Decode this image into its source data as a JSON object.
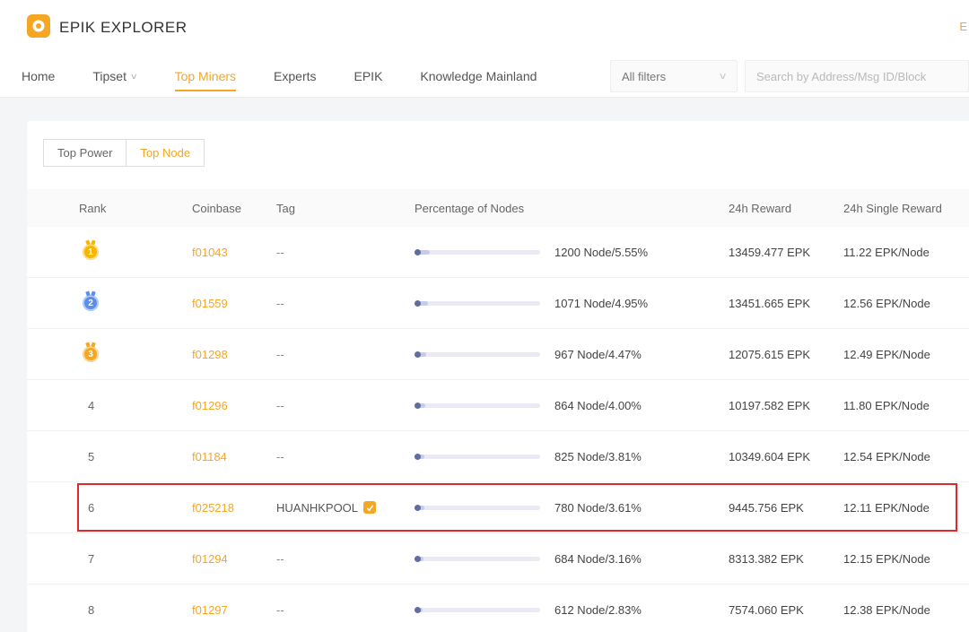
{
  "brand": {
    "name": "EPIK EXPLORER",
    "lang": "E"
  },
  "nav": {
    "items": [
      {
        "label": "Home"
      },
      {
        "label": "Tipset",
        "has_dropdown": true
      },
      {
        "label": "Top Miners",
        "active": true
      },
      {
        "label": "Experts"
      },
      {
        "label": "EPIK"
      },
      {
        "label": "Knowledge Mainland"
      }
    ]
  },
  "filters": {
    "all_filters_label": "All filters",
    "search_placeholder": "Search by Address/Msg ID/Block"
  },
  "tabs": {
    "top_power": "Top Power",
    "top_node": "Top Node"
  },
  "table": {
    "headers": [
      "Rank",
      "Coinbase",
      "Tag",
      "Percentage of Nodes",
      "24h Reward",
      "24h Single Reward"
    ],
    "rows": [
      {
        "rank": "1",
        "medal_color": "#f7b500",
        "coinbase": "f01043",
        "tag": "--",
        "nodes_text": "1200 Node/5.55%",
        "pct": 5.55,
        "reward": "13459.477 EPK",
        "single_reward": "11.22 EPK/Node"
      },
      {
        "rank": "2",
        "medal_color": "#5b8def",
        "coinbase": "f01559",
        "tag": "--",
        "nodes_text": "1071 Node/4.95%",
        "pct": 4.95,
        "reward": "13451.665 EPK",
        "single_reward": "12.56 EPK/Node"
      },
      {
        "rank": "3",
        "medal_color": "#f5a623",
        "coinbase": "f01298",
        "tag": "--",
        "nodes_text": "967 Node/4.47%",
        "pct": 4.47,
        "reward": "12075.615 EPK",
        "single_reward": "12.49 EPK/Node"
      },
      {
        "rank": "4",
        "coinbase": "f01296",
        "tag": "--",
        "nodes_text": "864 Node/4.00%",
        "pct": 4.0,
        "reward": "10197.582 EPK",
        "single_reward": "11.80 EPK/Node"
      },
      {
        "rank": "5",
        "coinbase": "f01184",
        "tag": "--",
        "nodes_text": "825 Node/3.81%",
        "pct": 3.81,
        "reward": "10349.604 EPK",
        "single_reward": "12.54 EPK/Node"
      },
      {
        "rank": "6",
        "coinbase": "f025218",
        "tag": "HUANHKPOOL",
        "tag_verified": true,
        "highlighted": true,
        "nodes_text": "780 Node/3.61%",
        "pct": 3.61,
        "reward": "9445.756 EPK",
        "single_reward": "12.11 EPK/Node"
      },
      {
        "rank": "7",
        "coinbase": "f01294",
        "tag": "--",
        "nodes_text": "684 Node/3.16%",
        "pct": 3.16,
        "reward": "8313.382 EPK",
        "single_reward": "12.15 EPK/Node"
      },
      {
        "rank": "8",
        "coinbase": "f01297",
        "tag": "--",
        "nodes_text": "612 Node/2.83%",
        "pct": 2.83,
        "reward": "7574.060 EPK",
        "single_reward": "12.38 EPK/Node"
      }
    ]
  },
  "colors": {
    "accent": "#f5a623",
    "link": "#f5a623",
    "highlight_border": "#e02a2a",
    "bar_track": "#e9eaf4",
    "bar_fill": "#c5cbe9",
    "bar_dot": "#5f6e9e"
  }
}
